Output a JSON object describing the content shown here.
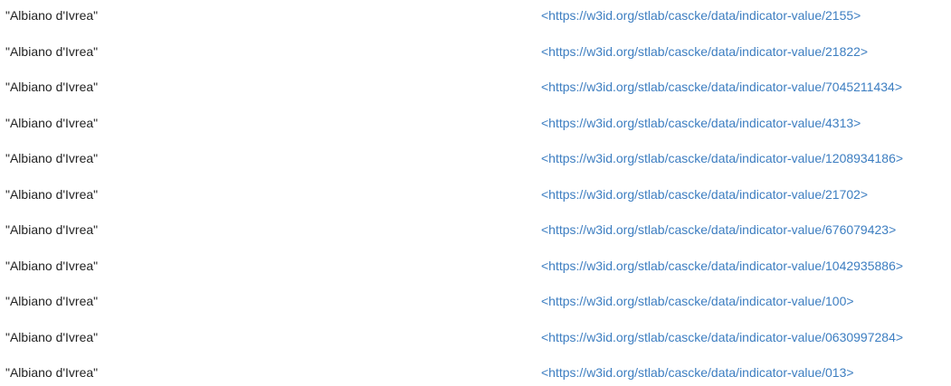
{
  "results": {
    "rows": [
      {
        "literal": "\"Albiano d'Ivrea\"",
        "uri": "<https://w3id.org/stlab/cascke/data/indicator-value/2155>"
      },
      {
        "literal": "\"Albiano d'Ivrea\"",
        "uri": "<https://w3id.org/stlab/cascke/data/indicator-value/21822>"
      },
      {
        "literal": "\"Albiano d'Ivrea\"",
        "uri": "<https://w3id.org/stlab/cascke/data/indicator-value/7045211434>"
      },
      {
        "literal": "\"Albiano d'Ivrea\"",
        "uri": "<https://w3id.org/stlab/cascke/data/indicator-value/4313>"
      },
      {
        "literal": "\"Albiano d'Ivrea\"",
        "uri": "<https://w3id.org/stlab/cascke/data/indicator-value/1208934186>"
      },
      {
        "literal": "\"Albiano d'Ivrea\"",
        "uri": "<https://w3id.org/stlab/cascke/data/indicator-value/21702>"
      },
      {
        "literal": "\"Albiano d'Ivrea\"",
        "uri": "<https://w3id.org/stlab/cascke/data/indicator-value/676079423>"
      },
      {
        "literal": "\"Albiano d'Ivrea\"",
        "uri": "<https://w3id.org/stlab/cascke/data/indicator-value/1042935886>"
      },
      {
        "literal": "\"Albiano d'Ivrea\"",
        "uri": "<https://w3id.org/stlab/cascke/data/indicator-value/100>"
      },
      {
        "literal": "\"Albiano d'Ivrea\"",
        "uri": "<https://w3id.org/stlab/cascke/data/indicator-value/0630997284>"
      },
      {
        "literal": "\"Albiano d'Ivrea\"",
        "uri": "<https://w3id.org/stlab/cascke/data/indicator-value/013>"
      }
    ]
  },
  "colors": {
    "literal_text": "#222222",
    "link": "#3d7ec1",
    "background": "#ffffff"
  }
}
